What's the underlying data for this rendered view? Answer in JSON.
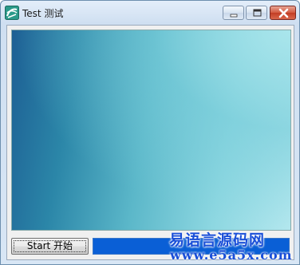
{
  "window": {
    "title": "Test 测试",
    "icon": "app-logo-icon",
    "controls": [
      "minimize-icon",
      "maximize-icon",
      "close-icon"
    ]
  },
  "main": {
    "start_button_label": "Start 开始",
    "progress_value": 1.0
  },
  "watermark": {
    "name": "易语言源码网",
    "url": "www.e5a5x.com"
  },
  "colors": {
    "progress_fill": "#0a5fd6",
    "close_button": "#c94a33",
    "watermark": "#1a4fd8"
  }
}
